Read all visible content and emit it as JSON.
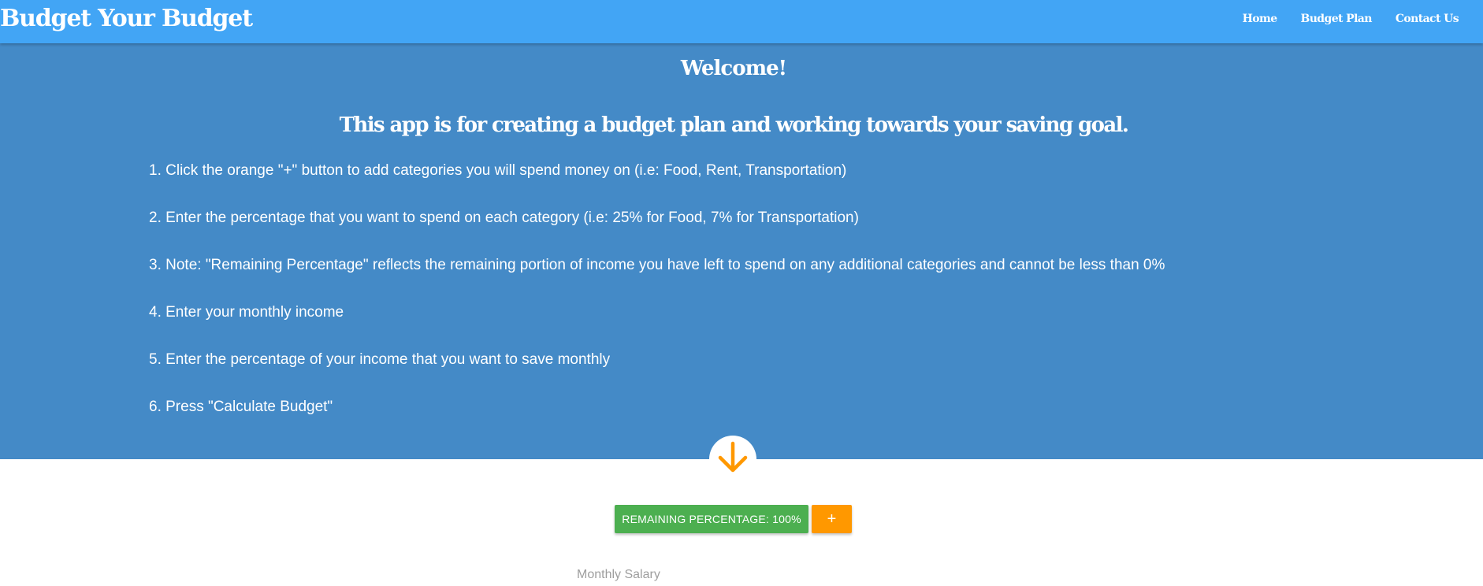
{
  "navbar": {
    "brand": "Budget Your Budget",
    "links": [
      "Home",
      "Budget Plan",
      "Contact Us"
    ]
  },
  "hero": {
    "welcome": "Welcome!",
    "subtitle": "This app is for creating a budget plan and working towards your saving goal.",
    "steps": [
      "1. Click the orange \"+\" button to add categories you will spend money on (i.e: Food, Rent, Transportation)",
      "2. Enter the percentage that you want to spend on each category (i.e: 25% for Food, 7% for Transportation)",
      "3. Note: \"Remaining Percentage\" reflects the remaining portion of income you have left to spend on any additional categories and cannot be less than 0%",
      "4. Enter your monthly income",
      "5. Enter the percentage of your income that you want to save monthly",
      "6. Press \"Calculate Budget\""
    ],
    "scroll_icon": "arrow-down-icon"
  },
  "controls": {
    "remaining_label": "Remaining Percentage: 100%",
    "add_label": "+",
    "salary_placeholder": "Monthly Salary"
  },
  "colors": {
    "navbar": "#42a5f5",
    "hero": "#448ac7",
    "remaining_button": "#4caf50",
    "add_button": "#ff9800",
    "arrow": "#ff9800"
  }
}
